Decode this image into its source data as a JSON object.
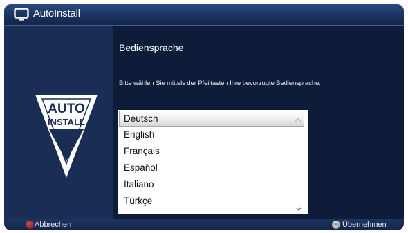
{
  "window": {
    "title": "AutoInstall",
    "icon": "tv-icon"
  },
  "logo": {
    "line1": "AUTO",
    "line2": "INSTALL"
  },
  "main": {
    "heading": "Bediensprache",
    "instruction": "Bitte wählen Sie mittels der Pfeiltasten Ihre bevorzugte Bediensprache."
  },
  "languages": {
    "selected": "Deutsch",
    "items": [
      "Deutsch",
      "English",
      "Français",
      "Español",
      "Italiano",
      "Türkçe"
    ]
  },
  "footer": {
    "cancel_label": "Abbrechen",
    "cancel_key": "red-key",
    "accept_key_label": "OK",
    "accept_label": "Übernehmen"
  },
  "colors": {
    "background": "#0c1a36",
    "title_bar": "#1a335f",
    "side_panel": "#1a2d55",
    "list_background": "#ffffff",
    "cancel_key": "#a01c1c"
  }
}
